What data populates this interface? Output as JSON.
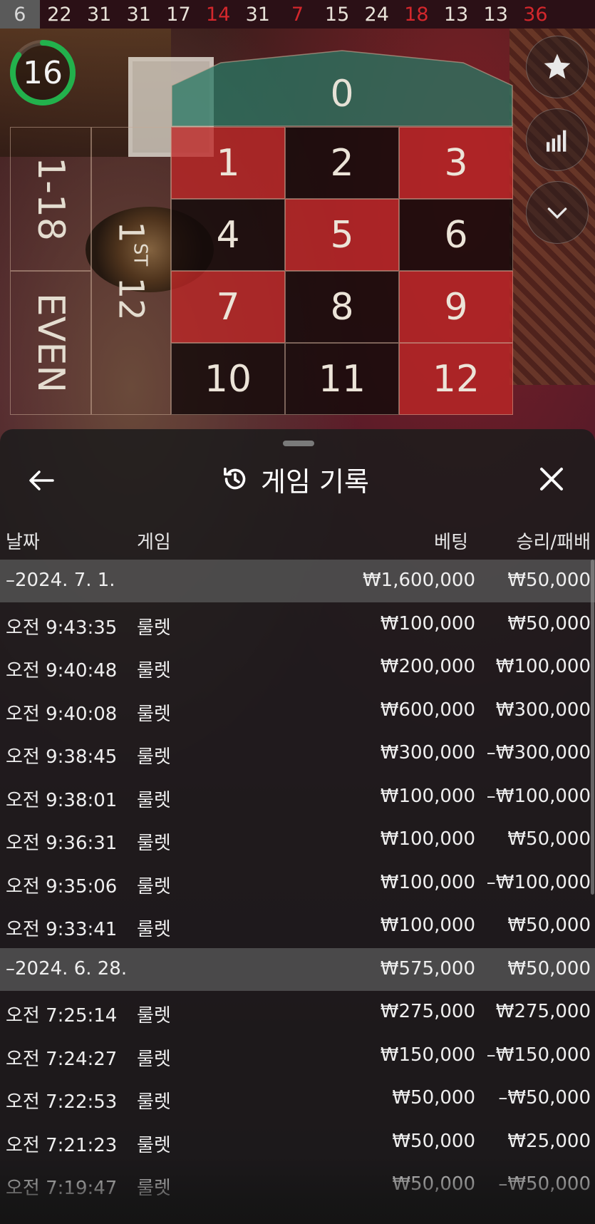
{
  "history_numbers": [
    {
      "n": "6",
      "color": "first"
    },
    {
      "n": "22",
      "color": "black"
    },
    {
      "n": "31",
      "color": "black"
    },
    {
      "n": "31",
      "color": "black"
    },
    {
      "n": "17",
      "color": "black"
    },
    {
      "n": "14",
      "color": "red"
    },
    {
      "n": "31",
      "color": "black"
    },
    {
      "n": "7",
      "color": "red"
    },
    {
      "n": "15",
      "color": "black"
    },
    {
      "n": "24",
      "color": "black"
    },
    {
      "n": "18",
      "color": "red"
    },
    {
      "n": "13",
      "color": "black"
    },
    {
      "n": "13",
      "color": "black"
    },
    {
      "n": "36",
      "color": "red"
    }
  ],
  "timer": {
    "seconds": "16",
    "fraction": 0.85
  },
  "side_buttons": [
    "star-icon",
    "stats-bars-icon",
    "chevron-down-icon"
  ],
  "table": {
    "zero": "0",
    "numbers": [
      {
        "n": "1",
        "c": "red"
      },
      {
        "n": "2",
        "c": "black"
      },
      {
        "n": "3",
        "c": "red"
      },
      {
        "n": "4",
        "c": "black"
      },
      {
        "n": "5",
        "c": "red"
      },
      {
        "n": "6",
        "c": "black"
      },
      {
        "n": "7",
        "c": "red"
      },
      {
        "n": "8",
        "c": "black"
      },
      {
        "n": "9",
        "c": "red"
      },
      {
        "n": "10",
        "c": "black"
      },
      {
        "n": "11",
        "c": "black"
      },
      {
        "n": "12",
        "c": "red"
      }
    ],
    "outside_low": "1-18",
    "outside_even": "EVEN",
    "dozen_prefix": "1",
    "dozen_sup": "ST",
    "dozen_num": "12"
  },
  "sheet": {
    "title": "게임 기록",
    "columns": {
      "date": "날짜",
      "game": "게임",
      "bet": "베팅",
      "win_loss": "승리/패배"
    },
    "rows": [
      {
        "type": "group",
        "time": "–2024. 7. 1.",
        "game": "",
        "bet": "₩1,600,000",
        "pl": "₩50,000"
      },
      {
        "type": "item",
        "time": "오전 9:43:35",
        "game": "룰렛",
        "bet": "₩100,000",
        "pl": "₩50,000"
      },
      {
        "type": "item",
        "time": "오전 9:40:48",
        "game": "룰렛",
        "bet": "₩200,000",
        "pl": "₩100,000"
      },
      {
        "type": "item",
        "time": "오전 9:40:08",
        "game": "룰렛",
        "bet": "₩600,000",
        "pl": "₩300,000"
      },
      {
        "type": "item",
        "time": "오전 9:38:45",
        "game": "룰렛",
        "bet": "₩300,000",
        "pl": "–₩300,000"
      },
      {
        "type": "item",
        "time": "오전 9:38:01",
        "game": "룰렛",
        "bet": "₩100,000",
        "pl": "–₩100,000"
      },
      {
        "type": "item",
        "time": "오전 9:36:31",
        "game": "룰렛",
        "bet": "₩100,000",
        "pl": "₩50,000"
      },
      {
        "type": "item",
        "time": "오전 9:35:06",
        "game": "룰렛",
        "bet": "₩100,000",
        "pl": "–₩100,000"
      },
      {
        "type": "item",
        "time": "오전 9:33:41",
        "game": "룰렛",
        "bet": "₩100,000",
        "pl": "₩50,000"
      },
      {
        "type": "group",
        "time": "–2024. 6. 28.",
        "game": "",
        "bet": "₩575,000",
        "pl": "₩50,000"
      },
      {
        "type": "item",
        "time": "오전 7:25:14",
        "game": "룰렛",
        "bet": "₩275,000",
        "pl": "₩275,000"
      },
      {
        "type": "item",
        "time": "오전 7:24:27",
        "game": "룰렛",
        "bet": "₩150,000",
        "pl": "–₩150,000"
      },
      {
        "type": "item",
        "time": "오전 7:22:53",
        "game": "룰렛",
        "bet": "₩50,000",
        "pl": "–₩50,000"
      },
      {
        "type": "item",
        "time": "오전 7:21:23",
        "game": "룰렛",
        "bet": "₩50,000",
        "pl": "₩25,000"
      },
      {
        "type": "item",
        "time": "오전 7:19:47",
        "game": "룰렛",
        "bet": "₩50,000",
        "pl": "–₩50,000"
      }
    ]
  }
}
